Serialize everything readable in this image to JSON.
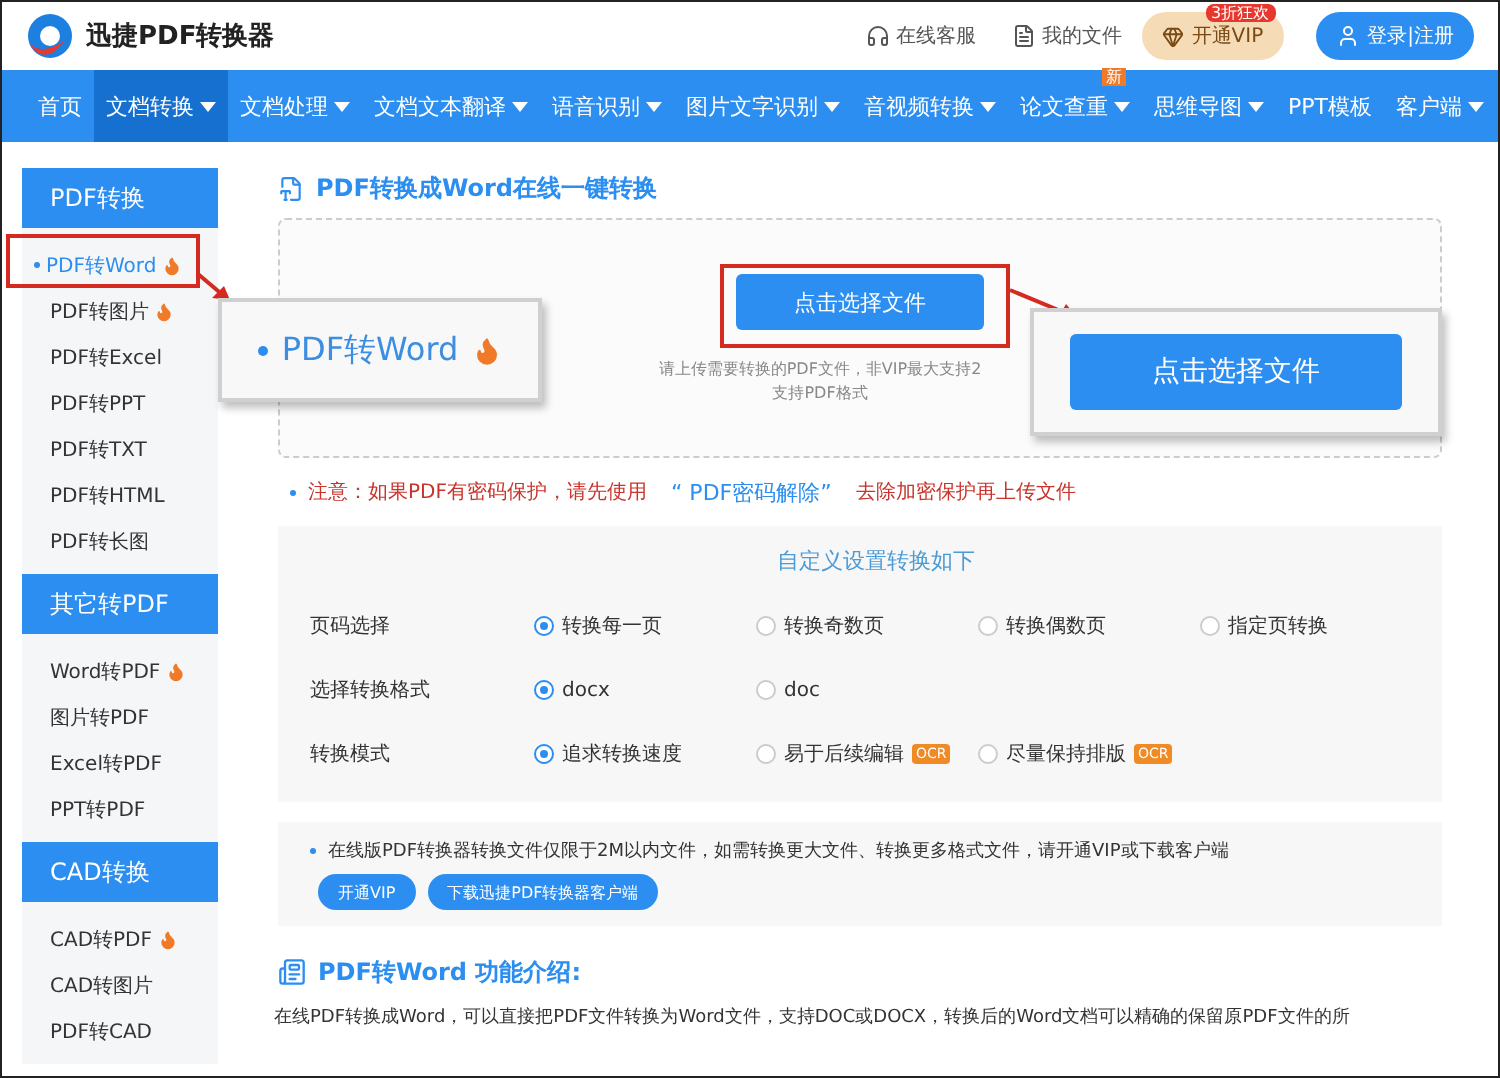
{
  "header": {
    "logo_text": "迅捷PDF转换器",
    "links": [
      {
        "kind": "headset",
        "label": "在线客服"
      },
      {
        "kind": "file",
        "label": "我的文件"
      }
    ],
    "vip_button": {
      "label": "开通VIP",
      "badge": "3折狂欢"
    },
    "login_button": "登录|注册"
  },
  "nav": [
    {
      "label": "首页",
      "dropdown": false,
      "selected": false
    },
    {
      "label": "文档转换",
      "dropdown": true,
      "selected": true
    },
    {
      "label": "文档处理",
      "dropdown": true,
      "selected": false
    },
    {
      "label": "文档文本翻译",
      "dropdown": true,
      "selected": false
    },
    {
      "label": "语音识别",
      "dropdown": true,
      "selected": false
    },
    {
      "label": "图片文字识别",
      "dropdown": true,
      "selected": false
    },
    {
      "label": "音视频转换",
      "dropdown": true,
      "selected": false
    },
    {
      "label": "论文查重",
      "dropdown": true,
      "selected": false,
      "badge": "新"
    },
    {
      "label": "思维导图",
      "dropdown": true,
      "selected": false
    },
    {
      "label": "PPT模板",
      "dropdown": false,
      "selected": false
    },
    {
      "label": "客户端",
      "dropdown": true,
      "selected": false
    }
  ],
  "sidebar": [
    {
      "title": "PDF转换",
      "items": [
        {
          "label": "PDF转Word",
          "hot": true,
          "selected": true
        },
        {
          "label": "PDF转图片",
          "hot": true,
          "selected": false
        },
        {
          "label": "PDF转Excel",
          "hot": false,
          "selected": false
        },
        {
          "label": "PDF转PPT",
          "hot": false,
          "selected": false
        },
        {
          "label": "PDF转TXT",
          "hot": false,
          "selected": false
        },
        {
          "label": "PDF转HTML",
          "hot": false,
          "selected": false
        },
        {
          "label": "PDF转长图",
          "hot": false,
          "selected": false
        }
      ]
    },
    {
      "title": "其它转PDF",
      "items": [
        {
          "label": "Word转PDF",
          "hot": true,
          "selected": false
        },
        {
          "label": "图片转PDF",
          "hot": false,
          "selected": false
        },
        {
          "label": "Excel转PDF",
          "hot": false,
          "selected": false
        },
        {
          "label": "PPT转PDF",
          "hot": false,
          "selected": false
        }
      ]
    },
    {
      "title": "CAD转换",
      "items": [
        {
          "label": "CAD转PDF",
          "hot": true,
          "selected": false
        },
        {
          "label": "CAD转图片",
          "hot": false,
          "selected": false
        },
        {
          "label": "PDF转CAD",
          "hot": false,
          "selected": false
        }
      ]
    }
  ],
  "main": {
    "title": "PDF转换成Word在线一键转换",
    "upload": {
      "button": "点击选择文件",
      "hint_lines": [
        "请上传需要转换的PDF文件，非VIP最大支持2",
        "支持PDF格式"
      ]
    },
    "callouts": {
      "sidebar_item": {
        "label": "PDF转Word",
        "hot": true
      },
      "button": "点击选择文件"
    },
    "notice": {
      "prefix": "注意：如果PDF有密码保护，请先使用",
      "link": "“ PDF密码解除”",
      "suffix": "去除加密保护再上传文件"
    },
    "settings": {
      "title": "自定义设置转换如下",
      "rows": [
        {
          "label": "页码选择",
          "options": [
            {
              "label": "转换每一页",
              "selected": true
            },
            {
              "label": "转换奇数页",
              "selected": false
            },
            {
              "label": "转换偶数页",
              "selected": false
            },
            {
              "label": "指定页转换",
              "selected": false
            }
          ]
        },
        {
          "label": "选择转换格式",
          "options": [
            {
              "label": "docx",
              "selected": true
            },
            {
              "label": "doc",
              "selected": false
            }
          ]
        },
        {
          "label": "转换模式",
          "options": [
            {
              "label": "追求转换速度",
              "selected": true
            },
            {
              "label": "易于后续编辑",
              "selected": false,
              "badge": "OCR"
            },
            {
              "label": "尽量保持排版",
              "selected": false,
              "badge": "OCR"
            }
          ]
        }
      ]
    },
    "info": {
      "text": "在线版PDF转换器转换文件仅限于2M以内文件，如需转换更大文件、转换更多格式文件，请开通VIP或下载客户端",
      "buttons": [
        "开通VIP",
        "下载迅捷PDF转换器客户端"
      ]
    },
    "intro": {
      "title": "PDF转Word 功能介绍:",
      "text": "在线PDF转换成Word，可以直接把PDF文件转换为Word文件，支持DOC或DOCX，转换后的Word文档可以精确的保留原PDF文件的所"
    }
  }
}
